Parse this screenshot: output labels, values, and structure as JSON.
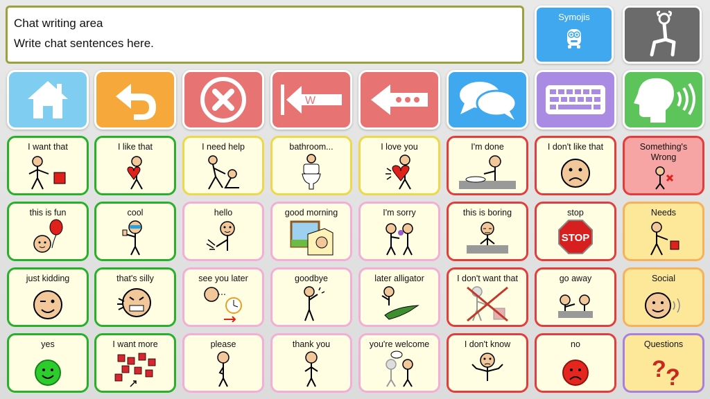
{
  "chat": {
    "title": "Chat writing area",
    "placeholder_text": "Write chat sentences here."
  },
  "top_buttons": {
    "symojis": "Symojis"
  },
  "toolbar": [
    {
      "icon": "home-icon",
      "color": "#7fcdf0"
    },
    {
      "icon": "undo-icon",
      "color": "#f6a93a"
    },
    {
      "icon": "clear-icon",
      "color": "#e87373"
    },
    {
      "icon": "delete-word-icon",
      "color": "#e87373"
    },
    {
      "icon": "backspace-icon",
      "color": "#e87373"
    },
    {
      "icon": "chat-bubbles-icon",
      "color": "#3fa8ef"
    },
    {
      "icon": "keyboard-icon",
      "color": "#a98be4"
    },
    {
      "icon": "speak-icon",
      "color": "#5cc45a"
    }
  ],
  "grid": [
    [
      "I want that",
      "I like that",
      "I need help",
      "bathroom...",
      "I love you",
      "I'm done",
      "I don't like that",
      "Something's Wrong"
    ],
    [
      "this is fun",
      "cool",
      "hello",
      "good morning",
      "I'm sorry",
      "this is boring",
      "stop",
      "Needs"
    ],
    [
      "just kidding",
      "that's silly",
      "see you later",
      "goodbye",
      "later alligator",
      "I don't want that",
      "go away",
      "Social"
    ],
    [
      "yes",
      "I want more",
      "please",
      "thank you",
      "you're welcome",
      "I don't know",
      "no",
      "Questions"
    ]
  ],
  "stop_sign_text": "STOP",
  "colors": {
    "chat_border": "#9aa23b",
    "green": "#27b02a",
    "yellow": "#ecd84a",
    "pink": "#f3aed7",
    "red": "#e23d3d",
    "cell_bg": "#fffde2"
  }
}
